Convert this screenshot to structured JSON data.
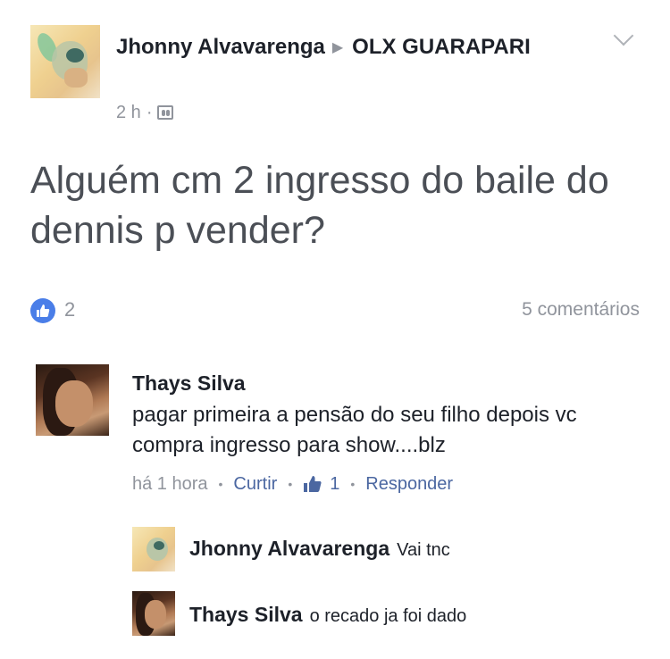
{
  "post": {
    "author": "Jhonny Alvavarenga",
    "group": "OLX GUARAPARI",
    "time": "2 h",
    "separator": "·",
    "text": "Alguém cm 2 ingresso do baile do dennis p vender?",
    "likes": "2",
    "comments_count": "5 comentários"
  },
  "comment": {
    "author": "Thays Silva",
    "text": "pagar primeira a pensão do seu filho depois vc compra ingresso para show....blz",
    "time": "há 1 hora",
    "like_label": "Curtir",
    "likes": "1",
    "reply_label": "Responder"
  },
  "replies": [
    {
      "author": "Jhonny Alvavarenga",
      "text": "Vai tnc"
    },
    {
      "author": "Thays Silva",
      "text": "o recado ja foi dado"
    }
  ],
  "colors": {
    "accent_blue": "#4a7ee8",
    "link_blue": "#4b67a1",
    "muted": "#90949c"
  }
}
